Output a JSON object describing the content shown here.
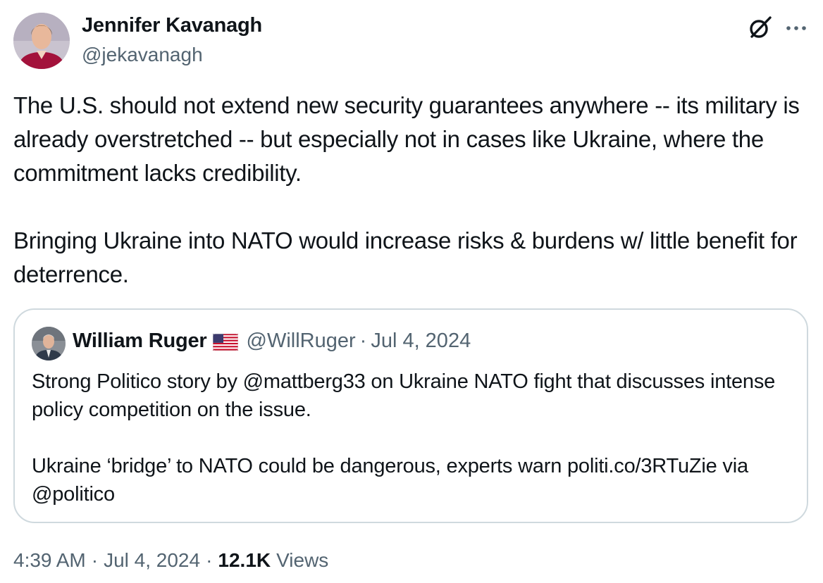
{
  "author": {
    "name": "Jennifer Kavanagh",
    "handle": "@jekavanagh",
    "avatar_icon": "person-avatar"
  },
  "header_icons": {
    "grok": "grok-icon",
    "more": "more-icon"
  },
  "tweet": {
    "paragraph1": "The U.S. should not extend new security guarantees anywhere -- its military is already overstretched -- but especially not in cases like Ukraine, where the commitment lacks credibility.",
    "paragraph2": "Bringing Ukraine into NATO would increase risks & burdens w/ little benefit for deterrence."
  },
  "quote": {
    "name": "William Ruger",
    "flag_icon": "us-flag-icon",
    "handle": "@WillRuger",
    "dot": "·",
    "date": "Jul 4, 2024",
    "paragraph1": "Strong Politico story by @mattberg33 on Ukraine NATO fight that discusses intense policy competition on the issue.",
    "paragraph2": "Ukraine ‘bridge’ to NATO could be dangerous, experts warn politi.co/3RTuZie via @politico"
  },
  "footer": {
    "time": "4:39 AM",
    "sep1": "·",
    "date": "Jul 4, 2024",
    "sep2": "·",
    "views_count": "12.1K",
    "views_label": "Views"
  },
  "colors": {
    "text_primary": "#0f1419",
    "text_secondary": "#536471",
    "border": "#cfd9de"
  }
}
